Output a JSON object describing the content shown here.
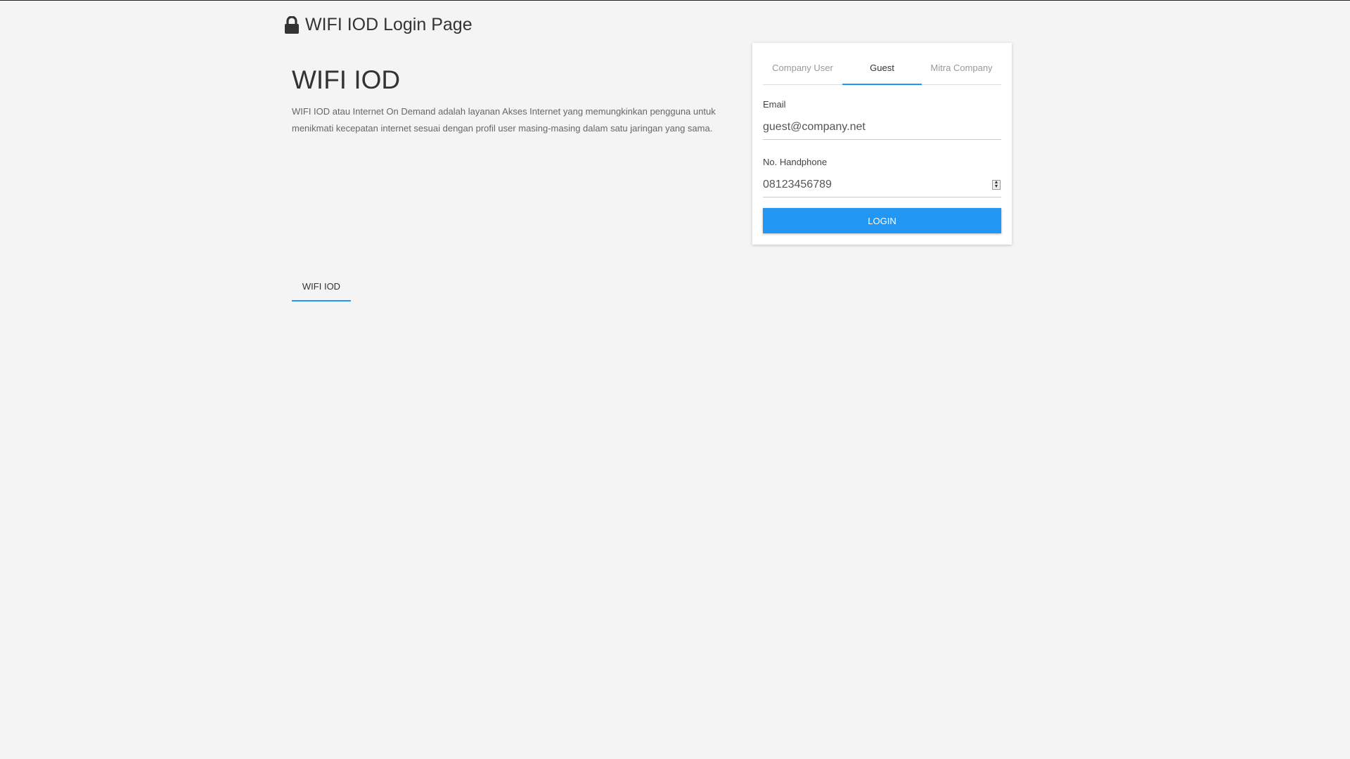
{
  "header": {
    "title": "WIFI IOD Login Page",
    "icon": "lock-icon"
  },
  "hero": {
    "title": "WIFI IOD",
    "description": "WIFI IOD atau Internet On Demand adalah layanan Akses Internet yang memungkinkan pengguna untuk menikmati kecepatan internet sesuai dengan profil user masing-masing dalam satu jaringan yang sama."
  },
  "login": {
    "tabs": [
      {
        "label": "Company User",
        "active": false
      },
      {
        "label": "Guest",
        "active": true
      },
      {
        "label": "Mitra Company",
        "active": false
      }
    ],
    "email_label": "Email",
    "email_value": "guest@company.net",
    "phone_label": "No. Handphone",
    "phone_value": "08123456789",
    "button_label": "LOGIN"
  },
  "bottom_tabs": {
    "items": [
      {
        "label": "WIFI IOD",
        "active": true
      }
    ]
  },
  "colors": {
    "accent": "#2196f3",
    "background": "#f4f4f4"
  }
}
